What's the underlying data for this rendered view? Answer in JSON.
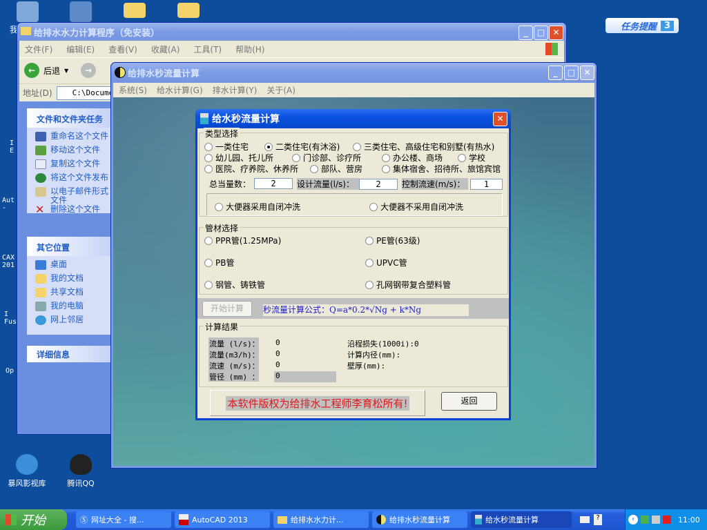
{
  "desktop": {
    "bottom_icons": [
      {
        "label": "暴风影视库"
      },
      {
        "label": "腾讯QQ"
      }
    ],
    "fragments": [
      "我",
      "I\nE",
      "Aut\n-",
      "CAX\n201",
      "I\nFus",
      "Op"
    ],
    "task_reminder": {
      "label": "任务提醒",
      "count": "3"
    }
  },
  "explorer": {
    "title": "给排水水力计算程序（免安装）",
    "menu": [
      "文件(F)",
      "编辑(E)",
      "查看(V)",
      "收藏(A)",
      "工具(T)",
      "帮助(H)"
    ],
    "back_label": "后退",
    "address_label": "地址(D)",
    "address_value": "C:\\Documer",
    "tasks_title": "文件和文件夹任务",
    "tasks": [
      "重命名这个文件",
      "移动这个文件",
      "复制这个文件",
      "将这个文件发布",
      "以电子邮件形式\n文件",
      "删除这个文件"
    ],
    "places_title": "其它位置",
    "places": [
      "桌面",
      "我的文档",
      "共享文档",
      "我的电脑",
      "网上邻居"
    ],
    "details_title": "详细信息"
  },
  "main_window": {
    "title": "给排水秒流量计算",
    "menu": [
      "系统(S)",
      "给水计算(G)",
      "排水计算(Y)",
      "关于(A)"
    ]
  },
  "dialog": {
    "title": "给水秒流量计算",
    "type_group": "类型选择",
    "types": [
      {
        "label": "一类住宅",
        "checked": false
      },
      {
        "label": "二类住宅(有沐浴)",
        "checked": true
      },
      {
        "label": "三类住宅、高级住宅和别墅(有热水)",
        "checked": false
      },
      {
        "label": "幼儿园、托儿所",
        "checked": false
      },
      {
        "label": "门诊部、诊疗所",
        "checked": false
      },
      {
        "label": "办公楼、商场",
        "checked": false
      },
      {
        "label": "学校",
        "checked": false
      },
      {
        "label": "医院、疗养院、休养所",
        "checked": false
      },
      {
        "label": "部队、营房",
        "checked": false
      },
      {
        "label": "集体宿舍、招待所、旅馆宾馆",
        "checked": false
      }
    ],
    "total_label": "总当量数：",
    "total_value": "2",
    "design_flow_label": "设计流量(l/s)：",
    "design_flow_value": "2",
    "velocity_label": "控制流速(m/s)：",
    "velocity_value": "1",
    "flush": [
      {
        "label": "大便器采用自闭冲洗",
        "checked": false
      },
      {
        "label": "大便器不采用自闭冲洗",
        "checked": false
      }
    ],
    "pipe_group": "管材选择",
    "pipes": [
      {
        "label": "PPR管(1.25MPa)",
        "checked": false
      },
      {
        "label": "PE管(63级)",
        "checked": false
      },
      {
        "label": "PB管",
        "checked": false
      },
      {
        "label": "UPVC管",
        "checked": false
      },
      {
        "label": "钢管、铸铁管",
        "checked": false
      },
      {
        "label": "孔网钢带复合塑料管",
        "checked": false
      }
    ],
    "start_button": "开始计算",
    "formula": "秒流量计算公式：Q=a*0.2*√Ng + k*Ng",
    "result_group": "计算结果",
    "results": [
      {
        "label": "流量 (l/s)：",
        "value": "0"
      },
      {
        "label": "流量(m3/h)：",
        "value": "0"
      },
      {
        "label": "流速 (m/s)：",
        "value": "0"
      },
      {
        "label": "管径 (mm) ：",
        "value": "0"
      }
    ],
    "results_right": [
      "沿程损失(1000i):0",
      "计算内径(mm):",
      "壁厚(mm):"
    ],
    "copyright": "本软件版权为给排水工程师李育松所有!",
    "return_button": "返回"
  },
  "taskbar": {
    "start": "开始",
    "tasks": [
      "网址大全 - 搜...",
      "AutoCAD 2013",
      "给排水水力计...",
      "给排水秒流量计算",
      "给水秒流量计算"
    ],
    "clock": "11:00"
  }
}
